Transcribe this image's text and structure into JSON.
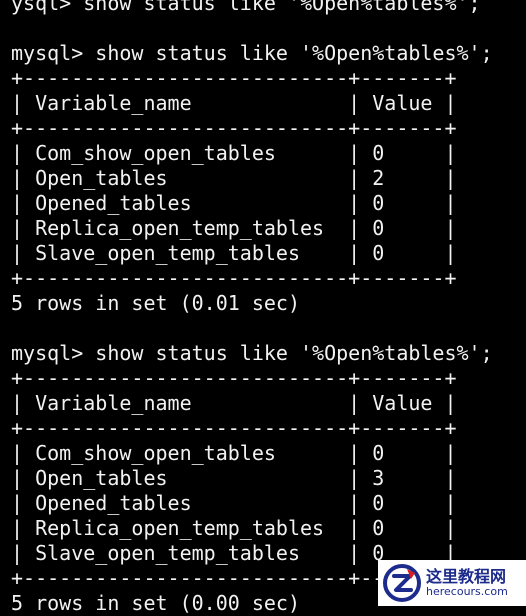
{
  "terminal": {
    "lines": [
      "ysql> show status like '%Open%tables%';",
      "",
      "mysql> show status like '%Open%tables%';",
      "+---------------------------+-------+",
      "| Variable_name             | Value |",
      "+---------------------------+-------+",
      "| Com_show_open_tables      | 0     |",
      "| Open_tables               | 2     |",
      "| Opened_tables             | 0     |",
      "| Replica_open_temp_tables  | 0     |",
      "| Slave_open_temp_tables    | 0     |",
      "+---------------------------+-------+",
      "5 rows in set (0.01 sec)",
      "",
      "mysql> show status like '%Open%tables%';",
      "+---------------------------+-------+",
      "| Variable_name             | Value |",
      "+---------------------------+-------+",
      "| Com_show_open_tables      | 0     |",
      "| Open_tables               | 3     |",
      "| Opened_tables             | 0     |",
      "| Replica_open_temp_tables  | 0     |",
      "| Slave_open_temp_tables    | 0     |",
      "+---------------------------+-------+",
      "5 rows in set (0.00 sec)"
    ]
  },
  "watermark": {
    "title": "这里教程网",
    "url": "herecours.com",
    "logo_icon": "z-logo-icon",
    "color": "#1d2b8c",
    "accent": "#d81e1e"
  }
}
